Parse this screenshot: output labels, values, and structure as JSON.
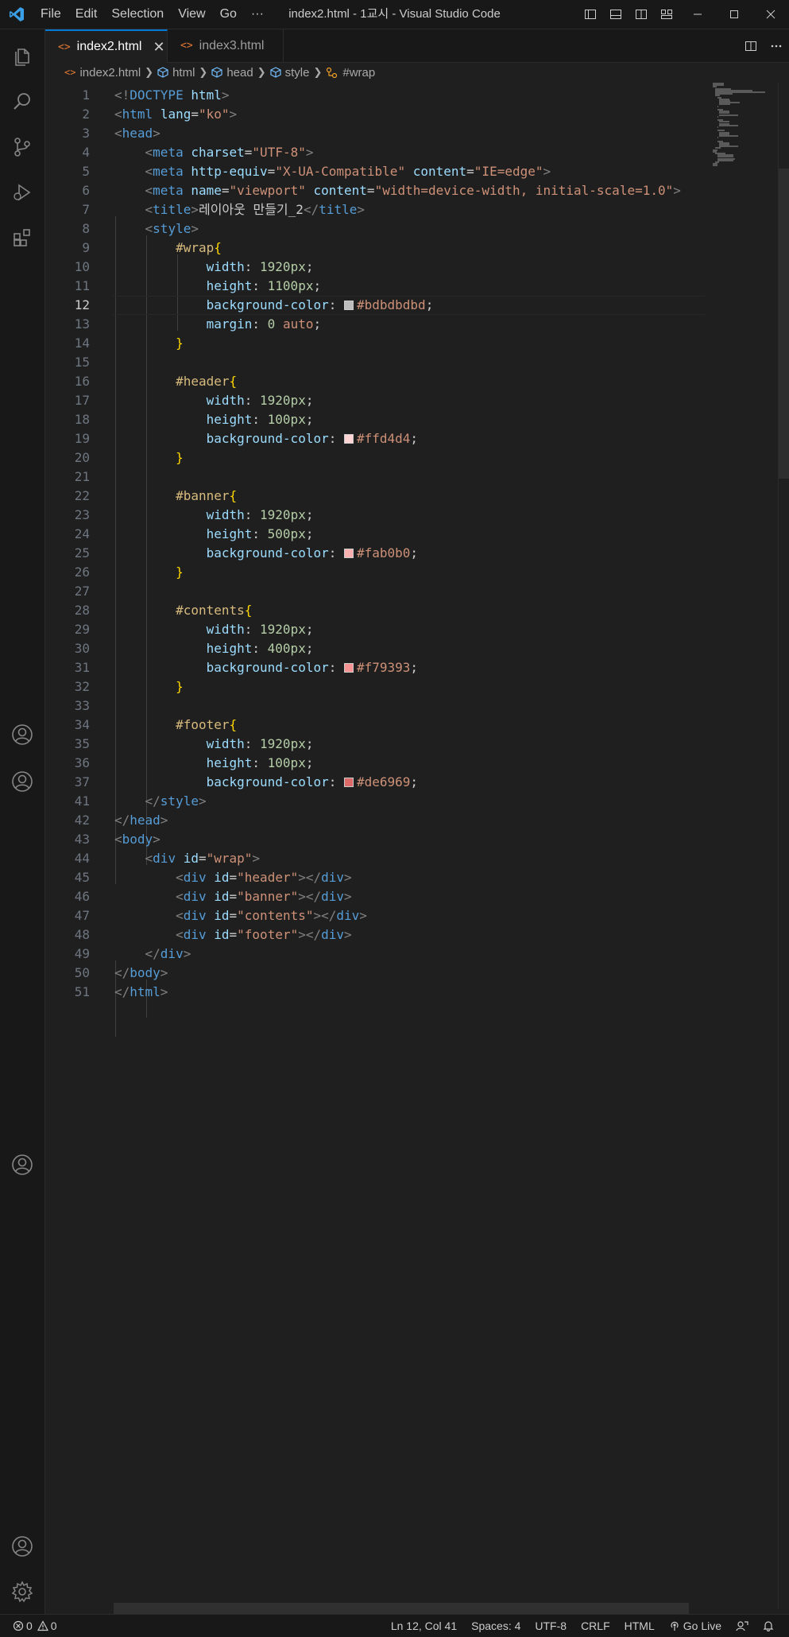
{
  "window": {
    "title": "index2.html - 1교시 - Visual Studio Code",
    "menu": [
      "File",
      "Edit",
      "Selection",
      "View",
      "Go",
      "···"
    ]
  },
  "tabs": [
    {
      "label": "index2.html",
      "active": true,
      "icon": "html-file-icon"
    },
    {
      "label": "index3.html",
      "active": false,
      "icon": "html-file-icon"
    }
  ],
  "breadcrumb": [
    "index2.html",
    "html",
    "head",
    "style",
    "#wrap"
  ],
  "editor": {
    "current_line": "12",
    "lines": [
      {
        "n": "1",
        "tokens": [
          [
            "t-br",
            "<!"
          ],
          [
            "t-tag",
            "DOCTYPE"
          ],
          [
            "t-text",
            " "
          ],
          [
            "t-attr",
            "html"
          ],
          [
            "t-br",
            ">"
          ]
        ]
      },
      {
        "n": "2",
        "tokens": [
          [
            "t-br",
            "<"
          ],
          [
            "t-tag",
            "html"
          ],
          [
            "t-text",
            " "
          ],
          [
            "t-attr",
            "lang"
          ],
          [
            "t-punc",
            "="
          ],
          [
            "t-str",
            "\"ko\""
          ],
          [
            "t-br",
            ">"
          ]
        ]
      },
      {
        "n": "3",
        "tokens": [
          [
            "t-br",
            "<"
          ],
          [
            "t-tag",
            "head"
          ],
          [
            "t-br",
            ">"
          ]
        ]
      },
      {
        "n": "4",
        "tokens": [
          [
            "t-text",
            "    "
          ],
          [
            "t-br",
            "<"
          ],
          [
            "t-tag",
            "meta"
          ],
          [
            "t-text",
            " "
          ],
          [
            "t-attr",
            "charset"
          ],
          [
            "t-punc",
            "="
          ],
          [
            "t-str",
            "\"UTF-8\""
          ],
          [
            "t-br",
            ">"
          ]
        ]
      },
      {
        "n": "5",
        "tokens": [
          [
            "t-text",
            "    "
          ],
          [
            "t-br",
            "<"
          ],
          [
            "t-tag",
            "meta"
          ],
          [
            "t-text",
            " "
          ],
          [
            "t-attr",
            "http-equiv"
          ],
          [
            "t-punc",
            "="
          ],
          [
            "t-str",
            "\"X-UA-Compatible\""
          ],
          [
            "t-text",
            " "
          ],
          [
            "t-attr",
            "content"
          ],
          [
            "t-punc",
            "="
          ],
          [
            "t-str",
            "\"IE=edge\""
          ],
          [
            "t-br",
            ">"
          ]
        ]
      },
      {
        "n": "6",
        "tokens": [
          [
            "t-text",
            "    "
          ],
          [
            "t-br",
            "<"
          ],
          [
            "t-tag",
            "meta"
          ],
          [
            "t-text",
            " "
          ],
          [
            "t-attr",
            "name"
          ],
          [
            "t-punc",
            "="
          ],
          [
            "t-str",
            "\"viewport\""
          ],
          [
            "t-text",
            " "
          ],
          [
            "t-attr",
            "content"
          ],
          [
            "t-punc",
            "="
          ],
          [
            "t-str",
            "\"width=device-width, initial-scale=1.0\""
          ],
          [
            "t-br",
            ">"
          ]
        ]
      },
      {
        "n": "7",
        "tokens": [
          [
            "t-text",
            "    "
          ],
          [
            "t-br",
            "<"
          ],
          [
            "t-tag",
            "title"
          ],
          [
            "t-br",
            ">"
          ],
          [
            "t-text",
            "레이아웃 만들기_2"
          ],
          [
            "t-br",
            "</"
          ],
          [
            "t-tag",
            "title"
          ],
          [
            "t-br",
            ">"
          ]
        ]
      },
      {
        "n": "8",
        "tokens": [
          [
            "t-text",
            "    "
          ],
          [
            "t-br",
            "<"
          ],
          [
            "t-tag",
            "style"
          ],
          [
            "t-br",
            ">"
          ]
        ]
      },
      {
        "n": "9",
        "tokens": [
          [
            "t-text",
            "        "
          ],
          [
            "t-sel",
            "#wrap"
          ],
          [
            "t-brace",
            "{"
          ]
        ]
      },
      {
        "n": "10",
        "tokens": [
          [
            "t-text",
            "            "
          ],
          [
            "t-prop",
            "width"
          ],
          [
            "t-punc",
            ": "
          ],
          [
            "t-num",
            "1920px"
          ],
          [
            "t-punc",
            ";"
          ]
        ]
      },
      {
        "n": "11",
        "tokens": [
          [
            "t-text",
            "            "
          ],
          [
            "t-prop",
            "height"
          ],
          [
            "t-punc",
            ": "
          ],
          [
            "t-num",
            "1100px"
          ],
          [
            "t-punc",
            ";"
          ]
        ]
      },
      {
        "n": "12",
        "tokens": [
          [
            "t-text",
            "            "
          ],
          [
            "t-prop",
            "background-color"
          ],
          [
            "t-punc",
            ": "
          ],
          [
            "swatch",
            "#bdbdbd"
          ],
          [
            "t-val",
            "#bdbdbdbd"
          ],
          [
            "t-punc",
            ";"
          ]
        ]
      },
      {
        "n": "13",
        "tokens": [
          [
            "t-text",
            "            "
          ],
          [
            "t-prop",
            "margin"
          ],
          [
            "t-punc",
            ": "
          ],
          [
            "t-num",
            "0"
          ],
          [
            "t-text",
            " "
          ],
          [
            "t-val",
            "auto"
          ],
          [
            "t-punc",
            ";"
          ]
        ]
      },
      {
        "n": "14",
        "tokens": [
          [
            "t-text",
            "        "
          ],
          [
            "t-brace",
            "}"
          ]
        ]
      },
      {
        "n": "15",
        "tokens": []
      },
      {
        "n": "16",
        "tokens": [
          [
            "t-text",
            "        "
          ],
          [
            "t-sel",
            "#header"
          ],
          [
            "t-brace",
            "{"
          ]
        ]
      },
      {
        "n": "17",
        "tokens": [
          [
            "t-text",
            "            "
          ],
          [
            "t-prop",
            "width"
          ],
          [
            "t-punc",
            ": "
          ],
          [
            "t-num",
            "1920px"
          ],
          [
            "t-punc",
            ";"
          ]
        ]
      },
      {
        "n": "18",
        "tokens": [
          [
            "t-text",
            "            "
          ],
          [
            "t-prop",
            "height"
          ],
          [
            "t-punc",
            ": "
          ],
          [
            "t-num",
            "100px"
          ],
          [
            "t-punc",
            ";"
          ]
        ]
      },
      {
        "n": "19",
        "tokens": [
          [
            "t-text",
            "            "
          ],
          [
            "t-prop",
            "background-color"
          ],
          [
            "t-punc",
            ": "
          ],
          [
            "swatch",
            "#ffd4d4"
          ],
          [
            "t-val",
            "#ffd4d4"
          ],
          [
            "t-punc",
            ";"
          ]
        ]
      },
      {
        "n": "20",
        "tokens": [
          [
            "t-text",
            "        "
          ],
          [
            "t-brace",
            "}"
          ]
        ]
      },
      {
        "n": "21",
        "tokens": []
      },
      {
        "n": "22",
        "tokens": [
          [
            "t-text",
            "        "
          ],
          [
            "t-sel",
            "#banner"
          ],
          [
            "t-brace",
            "{"
          ]
        ]
      },
      {
        "n": "23",
        "tokens": [
          [
            "t-text",
            "            "
          ],
          [
            "t-prop",
            "width"
          ],
          [
            "t-punc",
            ": "
          ],
          [
            "t-num",
            "1920px"
          ],
          [
            "t-punc",
            ";"
          ]
        ]
      },
      {
        "n": "24",
        "tokens": [
          [
            "t-text",
            "            "
          ],
          [
            "t-prop",
            "height"
          ],
          [
            "t-punc",
            ": "
          ],
          [
            "t-num",
            "500px"
          ],
          [
            "t-punc",
            ";"
          ]
        ]
      },
      {
        "n": "25",
        "tokens": [
          [
            "t-text",
            "            "
          ],
          [
            "t-prop",
            "background-color"
          ],
          [
            "t-punc",
            ": "
          ],
          [
            "swatch",
            "#fab0b0"
          ],
          [
            "t-val",
            "#fab0b0"
          ],
          [
            "t-punc",
            ";"
          ]
        ]
      },
      {
        "n": "26",
        "tokens": [
          [
            "t-text",
            "        "
          ],
          [
            "t-brace",
            "}"
          ]
        ]
      },
      {
        "n": "27",
        "tokens": []
      },
      {
        "n": "28",
        "tokens": [
          [
            "t-text",
            "        "
          ],
          [
            "t-sel",
            "#contents"
          ],
          [
            "t-brace",
            "{"
          ]
        ]
      },
      {
        "n": "29",
        "tokens": [
          [
            "t-text",
            "            "
          ],
          [
            "t-prop",
            "width"
          ],
          [
            "t-punc",
            ": "
          ],
          [
            "t-num",
            "1920px"
          ],
          [
            "t-punc",
            ";"
          ]
        ]
      },
      {
        "n": "30",
        "tokens": [
          [
            "t-text",
            "            "
          ],
          [
            "t-prop",
            "height"
          ],
          [
            "t-punc",
            ": "
          ],
          [
            "t-num",
            "400px"
          ],
          [
            "t-punc",
            ";"
          ]
        ]
      },
      {
        "n": "31",
        "tokens": [
          [
            "t-text",
            "            "
          ],
          [
            "t-prop",
            "background-color"
          ],
          [
            "t-punc",
            ": "
          ],
          [
            "swatch",
            "#f79393"
          ],
          [
            "t-val",
            "#f79393"
          ],
          [
            "t-punc",
            ";"
          ]
        ]
      },
      {
        "n": "32",
        "tokens": [
          [
            "t-text",
            "        "
          ],
          [
            "t-brace",
            "}"
          ]
        ]
      },
      {
        "n": "33",
        "tokens": []
      },
      {
        "n": "34",
        "tokens": [
          [
            "t-text",
            "        "
          ],
          [
            "t-sel",
            "#footer"
          ],
          [
            "t-brace",
            "{"
          ]
        ]
      },
      {
        "n": "35",
        "tokens": [
          [
            "t-text",
            "            "
          ],
          [
            "t-prop",
            "width"
          ],
          [
            "t-punc",
            ": "
          ],
          [
            "t-num",
            "1920px"
          ],
          [
            "t-punc",
            ";"
          ]
        ]
      },
      {
        "n": "36",
        "tokens": [
          [
            "t-text",
            "            "
          ],
          [
            "t-prop",
            "height"
          ],
          [
            "t-punc",
            ": "
          ],
          [
            "t-num",
            "100px"
          ],
          [
            "t-punc",
            ";"
          ]
        ]
      },
      {
        "n": "37",
        "tokens": [
          [
            "t-text",
            "            "
          ],
          [
            "t-prop",
            "background-color"
          ],
          [
            "t-punc",
            ": "
          ],
          [
            "swatch",
            "#de6969"
          ],
          [
            "t-val",
            "#de6969"
          ],
          [
            "t-punc",
            ";"
          ]
        ]
      },
      {
        "n": "41",
        "tokens": [
          [
            "t-text",
            "    "
          ],
          [
            "t-br",
            "</"
          ],
          [
            "t-tag",
            "style"
          ],
          [
            "t-br",
            ">"
          ]
        ]
      },
      {
        "n": "42",
        "tokens": [
          [
            "t-br",
            "</"
          ],
          [
            "t-tag",
            "head"
          ],
          [
            "t-br",
            ">"
          ]
        ]
      },
      {
        "n": "43",
        "tokens": [
          [
            "t-br",
            "<"
          ],
          [
            "t-tag",
            "body"
          ],
          [
            "t-br",
            ">"
          ]
        ]
      },
      {
        "n": "44",
        "tokens": [
          [
            "t-text",
            "    "
          ],
          [
            "t-br",
            "<"
          ],
          [
            "t-tag",
            "div"
          ],
          [
            "t-text",
            " "
          ],
          [
            "t-attr",
            "id"
          ],
          [
            "t-punc",
            "="
          ],
          [
            "t-str",
            "\"wrap\""
          ],
          [
            "t-br",
            ">"
          ]
        ]
      },
      {
        "n": "45",
        "tokens": [
          [
            "t-text",
            "        "
          ],
          [
            "t-br",
            "<"
          ],
          [
            "t-tag",
            "div"
          ],
          [
            "t-text",
            " "
          ],
          [
            "t-attr",
            "id"
          ],
          [
            "t-punc",
            "="
          ],
          [
            "t-str",
            "\"header\""
          ],
          [
            "t-br",
            "></"
          ],
          [
            "t-tag",
            "div"
          ],
          [
            "t-br",
            ">"
          ]
        ]
      },
      {
        "n": "46",
        "tokens": [
          [
            "t-text",
            "        "
          ],
          [
            "t-br",
            "<"
          ],
          [
            "t-tag",
            "div"
          ],
          [
            "t-text",
            " "
          ],
          [
            "t-attr",
            "id"
          ],
          [
            "t-punc",
            "="
          ],
          [
            "t-str",
            "\"banner\""
          ],
          [
            "t-br",
            "></"
          ],
          [
            "t-tag",
            "div"
          ],
          [
            "t-br",
            ">"
          ]
        ]
      },
      {
        "n": "47",
        "tokens": [
          [
            "t-text",
            "        "
          ],
          [
            "t-br",
            "<"
          ],
          [
            "t-tag",
            "div"
          ],
          [
            "t-text",
            " "
          ],
          [
            "t-attr",
            "id"
          ],
          [
            "t-punc",
            "="
          ],
          [
            "t-str",
            "\"contents\""
          ],
          [
            "t-br",
            "></"
          ],
          [
            "t-tag",
            "div"
          ],
          [
            "t-br",
            ">"
          ]
        ]
      },
      {
        "n": "48",
        "tokens": [
          [
            "t-text",
            "        "
          ],
          [
            "t-br",
            "<"
          ],
          [
            "t-tag",
            "div"
          ],
          [
            "t-text",
            " "
          ],
          [
            "t-attr",
            "id"
          ],
          [
            "t-punc",
            "="
          ],
          [
            "t-str",
            "\"footer\""
          ],
          [
            "t-br",
            "></"
          ],
          [
            "t-tag",
            "div"
          ],
          [
            "t-br",
            ">"
          ]
        ]
      },
      {
        "n": "49",
        "tokens": [
          [
            "t-text",
            "    "
          ],
          [
            "t-br",
            "</"
          ],
          [
            "t-tag",
            "div"
          ],
          [
            "t-br",
            ">"
          ]
        ]
      },
      {
        "n": "50",
        "tokens": [
          [
            "t-br",
            "</"
          ],
          [
            "t-tag",
            "body"
          ],
          [
            "t-br",
            ">"
          ]
        ]
      },
      {
        "n": "51",
        "tokens": [
          [
            "t-br",
            "</"
          ],
          [
            "t-tag",
            "html"
          ],
          [
            "t-br",
            ">"
          ]
        ]
      }
    ]
  },
  "statusbar": {
    "errors": "0",
    "warnings": "0",
    "position": "Ln 12, Col 41",
    "spaces": "Spaces: 4",
    "encoding": "UTF-8",
    "eol": "CRLF",
    "language": "HTML",
    "golive": "Go Live"
  },
  "colors": {
    "accent": "#0078d4",
    "editor_bg": "#1f1f1f",
    "chrome_bg": "#181818"
  }
}
